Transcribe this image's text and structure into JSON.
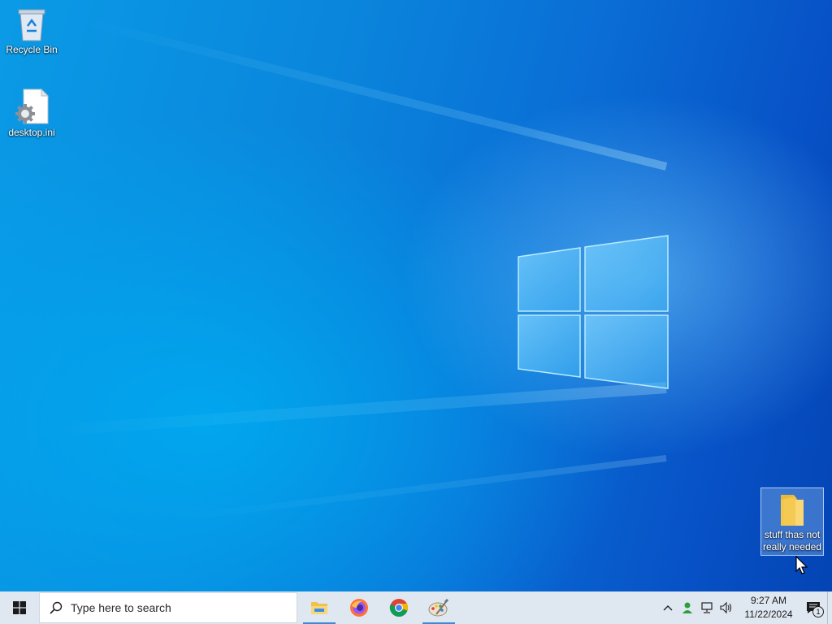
{
  "desktop": {
    "icons": [
      {
        "label": "Recycle Bin",
        "icon": "recycle-bin-icon"
      },
      {
        "label": "desktop.ini",
        "icon": "settings-file-icon"
      },
      {
        "label": "stuff thas not really needed",
        "icon": "folder-icon",
        "selected": true
      }
    ],
    "wallpaper": "windows-10-hero",
    "accent": "#0a86dc"
  },
  "taskbar": {
    "start_icon": "windows-logo-icon",
    "search_placeholder": "Type here to search",
    "apps": [
      {
        "name": "File Explorer",
        "icon": "file-explorer-icon",
        "active": true
      },
      {
        "name": "Firefox",
        "icon": "firefox-icon",
        "active": false
      },
      {
        "name": "Google Chrome",
        "icon": "chrome-icon",
        "active": false
      },
      {
        "name": "Paint",
        "icon": "paint-icon",
        "active": true
      }
    ],
    "tray": {
      "time": "9:27 AM",
      "date": "11/22/2024",
      "notification_count": "1"
    }
  }
}
